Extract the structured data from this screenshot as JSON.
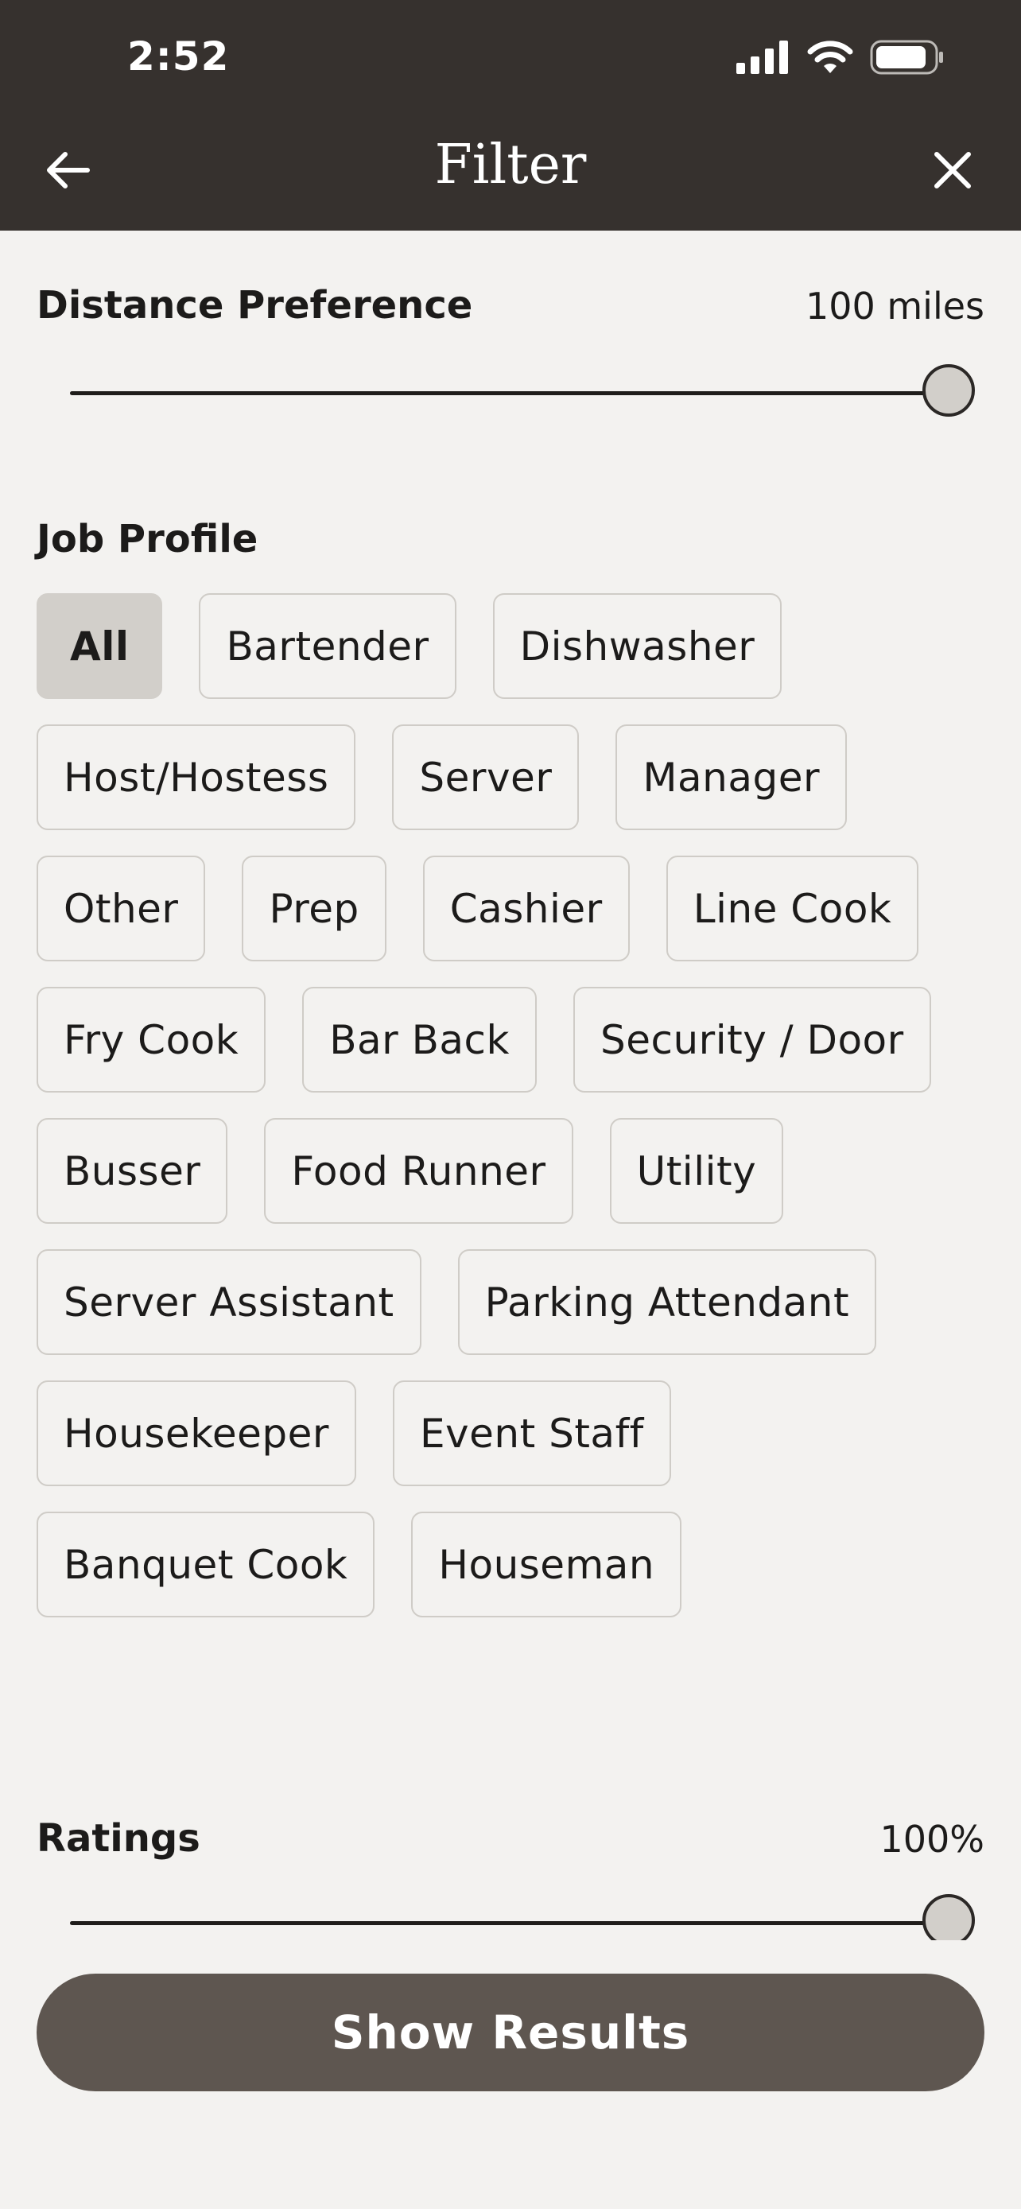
{
  "status_bar": {
    "time": "2:52"
  },
  "header": {
    "title": "Filter"
  },
  "distance": {
    "label": "Distance Preference",
    "value": "100 miles",
    "level": 1.0
  },
  "job_profile": {
    "label": "Job Profile",
    "options": [
      {
        "label": "All",
        "selected": true
      },
      {
        "label": "Bartender"
      },
      {
        "label": "Dishwasher"
      },
      {
        "label": "Host/Hostess"
      },
      {
        "label": "Server"
      },
      {
        "label": "Manager"
      },
      {
        "label": "Other"
      },
      {
        "label": "Prep"
      },
      {
        "label": "Cashier"
      },
      {
        "label": "Line Cook"
      },
      {
        "label": "Fry Cook"
      },
      {
        "label": "Bar Back"
      },
      {
        "label": "Security / Door"
      },
      {
        "label": "Busser"
      },
      {
        "label": "Food Runner"
      },
      {
        "label": "Utility"
      },
      {
        "label": "Server Assistant"
      },
      {
        "label": "Parking Attendant"
      },
      {
        "label": "Housekeeper"
      },
      {
        "label": "Event Staff"
      },
      {
        "label": "Banquet Cook"
      },
      {
        "label": "Houseman"
      }
    ]
  },
  "ratings": {
    "label": "Ratings",
    "value": "100%",
    "level": 1.0
  },
  "actions": {
    "show_results": "Show Results"
  },
  "colors": {
    "header_bg": "#36312e",
    "page_bg": "#f3f2f0",
    "chip_selected": "#d2cfca",
    "button_bg": "#5e5650"
  }
}
